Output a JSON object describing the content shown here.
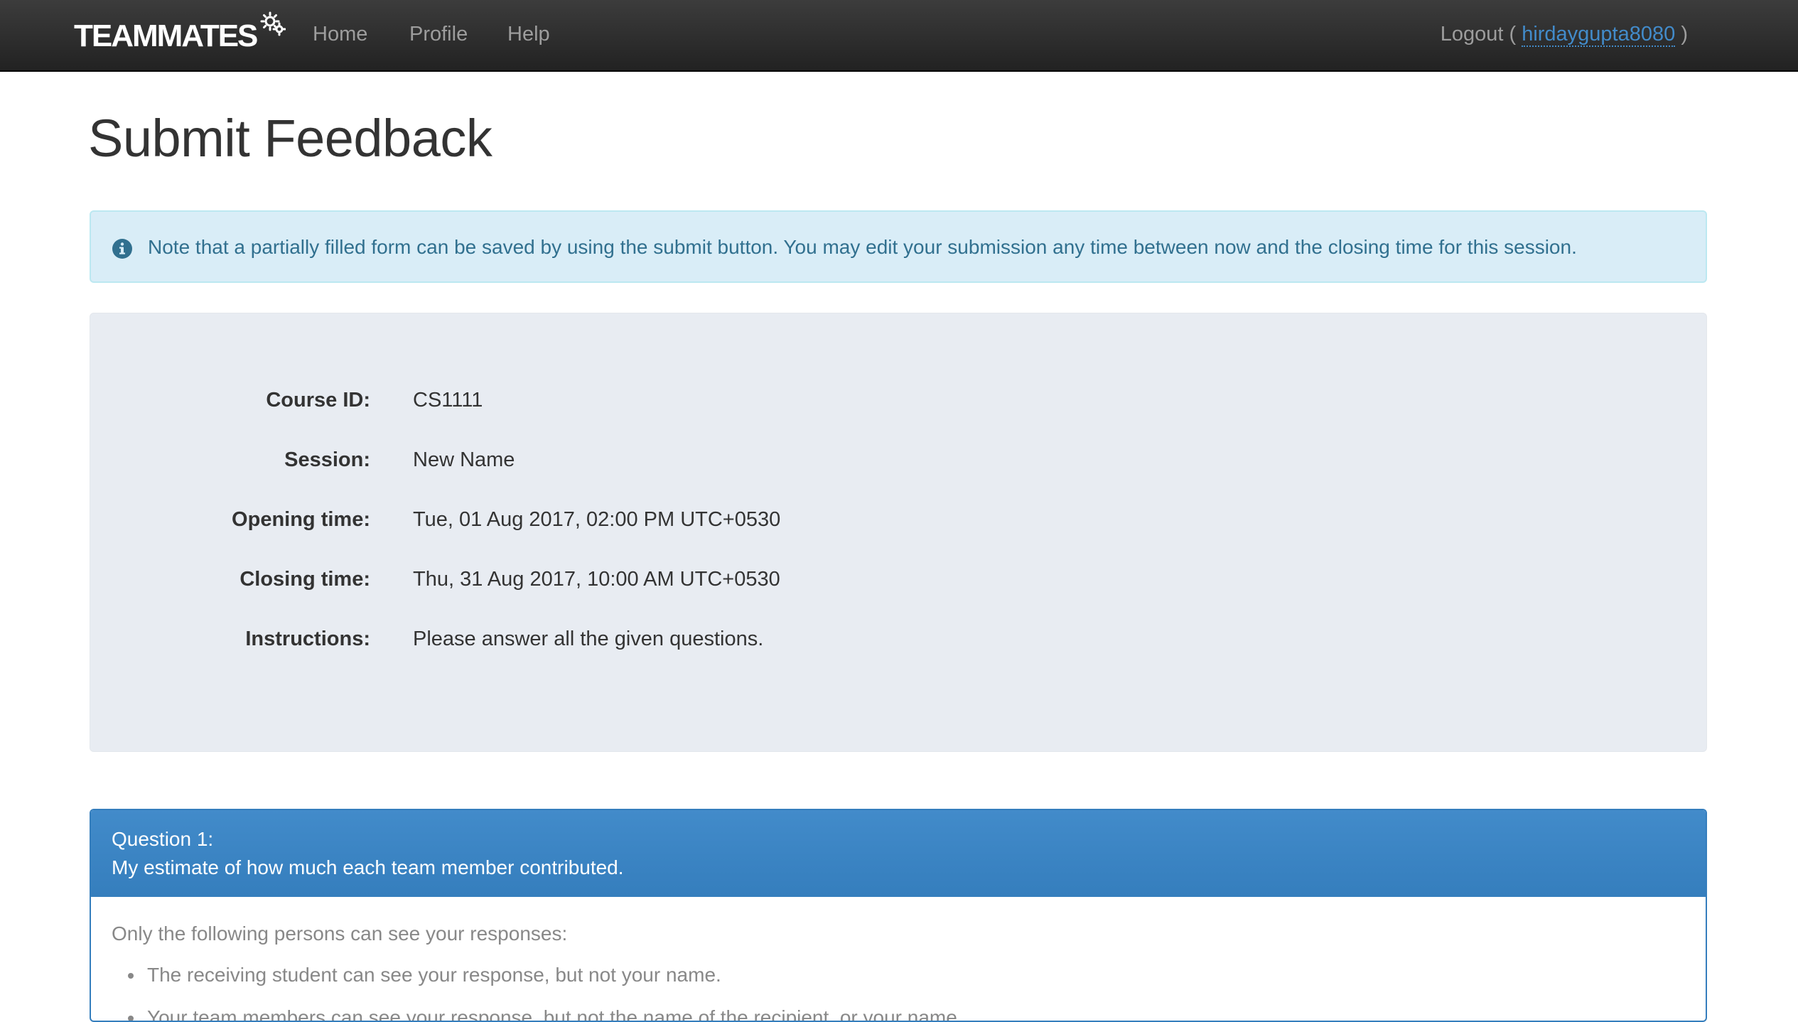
{
  "navbar": {
    "brand": "TEAMMATES",
    "links": {
      "home": "Home",
      "profile": "Profile",
      "help": "Help"
    },
    "logout_prefix": "Logout (",
    "user": "hirdaygupta8080",
    "logout_suffix": ")"
  },
  "page": {
    "title": "Submit Feedback"
  },
  "alert": {
    "icon": "info-icon",
    "text": "Note that a partially filled form can be saved by using the submit button. You may edit your submission any time between now and the closing time for this session."
  },
  "session_details": {
    "course_id": {
      "label": "Course ID:",
      "value": "CS1111"
    },
    "session": {
      "label": "Session:",
      "value": "New Name"
    },
    "opening_time": {
      "label": "Opening time:",
      "value": "Tue, 01 Aug 2017, 02:00 PM UTC+0530"
    },
    "closing_time": {
      "label": "Closing time:",
      "value": "Thu, 31 Aug 2017, 10:00 AM UTC+0530"
    },
    "instructions": {
      "label": "Instructions:",
      "value": "Please answer all the given questions."
    }
  },
  "question": {
    "number": "Question 1:",
    "text": "My estimate of how much each team member contributed.",
    "visibility_intro": "Only the following persons can see your responses:",
    "visibility_items": [
      "The receiving student can see your response, but not your name.",
      "Your team members can see your response, but not the name of the recipient, or your name."
    ]
  },
  "colors": {
    "navbar": "#222222",
    "link": "#428bca",
    "alert_bg": "#d9edf7",
    "alert_text": "#31708f",
    "well_bg": "#e8ecf2",
    "question_header": "#428bca"
  }
}
